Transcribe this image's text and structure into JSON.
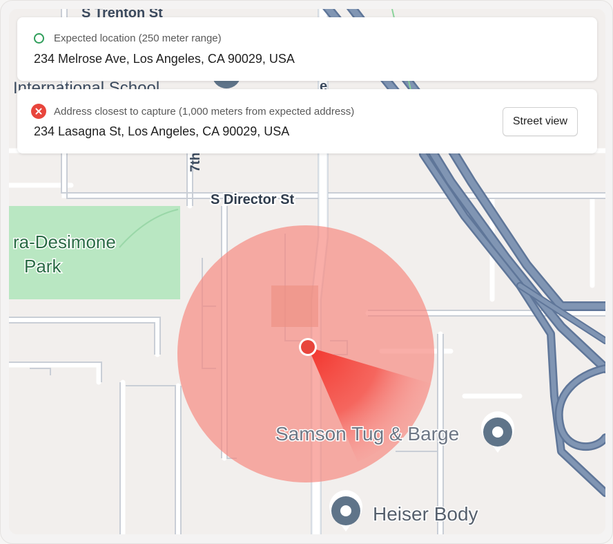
{
  "expected": {
    "label": "Expected location (250 meter range)",
    "address": "234 Melrose Ave, Los Angeles, CA 90029, USA",
    "status_color": "#2f9e5a"
  },
  "closest": {
    "label": "Address closest to capture (1,000 meters from expected address)",
    "address": "234 Lasagna St, Los Angeles, CA 90029, USA",
    "status_color": "#e8453c",
    "street_view_label": "Street view"
  },
  "map": {
    "labels": {
      "trenton": "S Trenton St",
      "school": "International School",
      "seventh": "7th",
      "director": "S Director St",
      "park_line1": "ra-Desimone",
      "park_line2": "Park",
      "samson": "Samson Tug & Barge",
      "heiser": "Heiser Body",
      "street_e": "e"
    },
    "pois": [
      "place-marker-icon",
      "place-marker-icon"
    ],
    "colors": {
      "range_circle": "#f7a29e",
      "capture_point": "#e8453c",
      "highway": "#7388a8",
      "park": "#b9e7c2"
    }
  }
}
